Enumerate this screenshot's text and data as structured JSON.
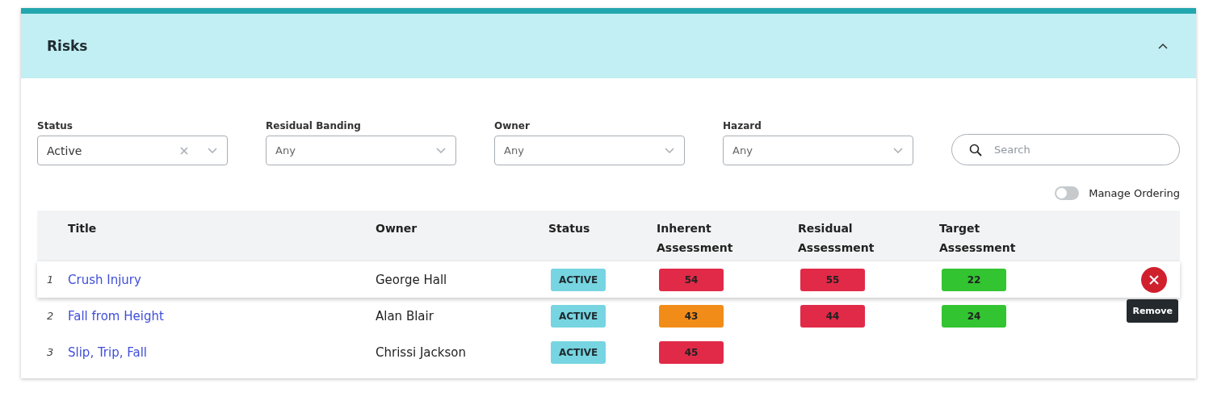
{
  "panel": {
    "title": "Risks",
    "expanded": true
  },
  "filters": [
    {
      "label": "Status",
      "value": "Active",
      "clearable": true
    },
    {
      "label": "Residual Banding",
      "placeholder": "Any",
      "clearable": false
    },
    {
      "label": "Owner",
      "placeholder": "Any",
      "clearable": false
    },
    {
      "label": "Hazard",
      "placeholder": "Any",
      "clearable": false
    }
  ],
  "search": {
    "placeholder": "Search"
  },
  "manage_ordering": {
    "label": "Manage Ordering",
    "on": false
  },
  "table": {
    "columns": [
      "Title",
      "Owner",
      "Status",
      "Inherent Assessment",
      "Residual Assessment",
      "Target Assessment"
    ],
    "rows": [
      {
        "number": "1",
        "title": "Crush Injury",
        "owner": "George Hall",
        "status": "ACTIVE",
        "inherent": {
          "score": "54",
          "color": "#e12a48"
        },
        "residual": {
          "score": "55",
          "color": "#e12a48"
        },
        "target": {
          "score": "22",
          "color": "#33c432"
        },
        "hovered": true,
        "remove_tooltip": "Remove"
      },
      {
        "number": "2",
        "title": "Fall from Height",
        "owner": "Alan Blair",
        "status": "ACTIVE",
        "inherent": {
          "score": "43",
          "color": "#f28c18"
        },
        "residual": {
          "score": "44",
          "color": "#e12a48"
        },
        "target": {
          "score": "24",
          "color": "#33c432"
        },
        "hovered": false
      },
      {
        "number": "3",
        "title": "Slip, Trip, Fall",
        "owner": "Chrissi Jackson",
        "status": "ACTIVE",
        "inherent": {
          "score": "45",
          "color": "#e12a48"
        },
        "hovered": false
      }
    ]
  }
}
